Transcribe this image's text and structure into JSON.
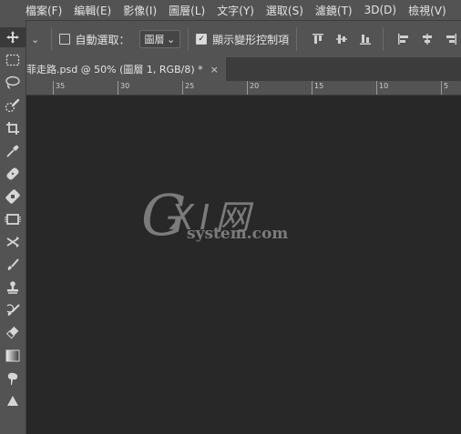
{
  "menubar": {
    "items": [
      {
        "label": "檔案(F)"
      },
      {
        "label": "編輯(E)"
      },
      {
        "label": "影像(I)"
      },
      {
        "label": "圖層(L)"
      },
      {
        "label": "文字(Y)"
      },
      {
        "label": "選取(S)"
      },
      {
        "label": "濾鏡(T)"
      },
      {
        "label": "3D(D)"
      },
      {
        "label": "檢視(V)"
      }
    ]
  },
  "options": {
    "auto_select_label": "自動選取：",
    "auto_select_checked": false,
    "auto_select_value": "圖層",
    "show_transform_label": "顯示變形控制項",
    "show_transform_checked": true
  },
  "document": {
    "tab_label": "菲走路.psd @ 50% (圖層 1, RGB/8) *",
    "close_symbol": "×",
    "zoom": "50%"
  },
  "ruler": {
    "labels": [
      "35",
      "30",
      "25",
      "20",
      "15",
      "10",
      "5"
    ]
  },
  "watermark": {
    "main": "XI网",
    "g": "G",
    "sub": "system.com"
  },
  "toolbar": {
    "tools": [
      "move-tool",
      "marquee-tool",
      "lasso-tool",
      "quick-selection-tool",
      "crop-tool",
      "eyedropper-tool",
      "healing-brush-tool",
      "patch-tool",
      "frame-tool",
      "content-aware-move-tool",
      "brush-tool",
      "clone-stamp-tool",
      "history-brush-tool",
      "eraser-tool",
      "gradient-tool",
      "blur-tool",
      "sharpen-tool"
    ]
  },
  "colors": {
    "panel": "#535353",
    "canvas": "#282828",
    "text": "#e4e4e4"
  }
}
